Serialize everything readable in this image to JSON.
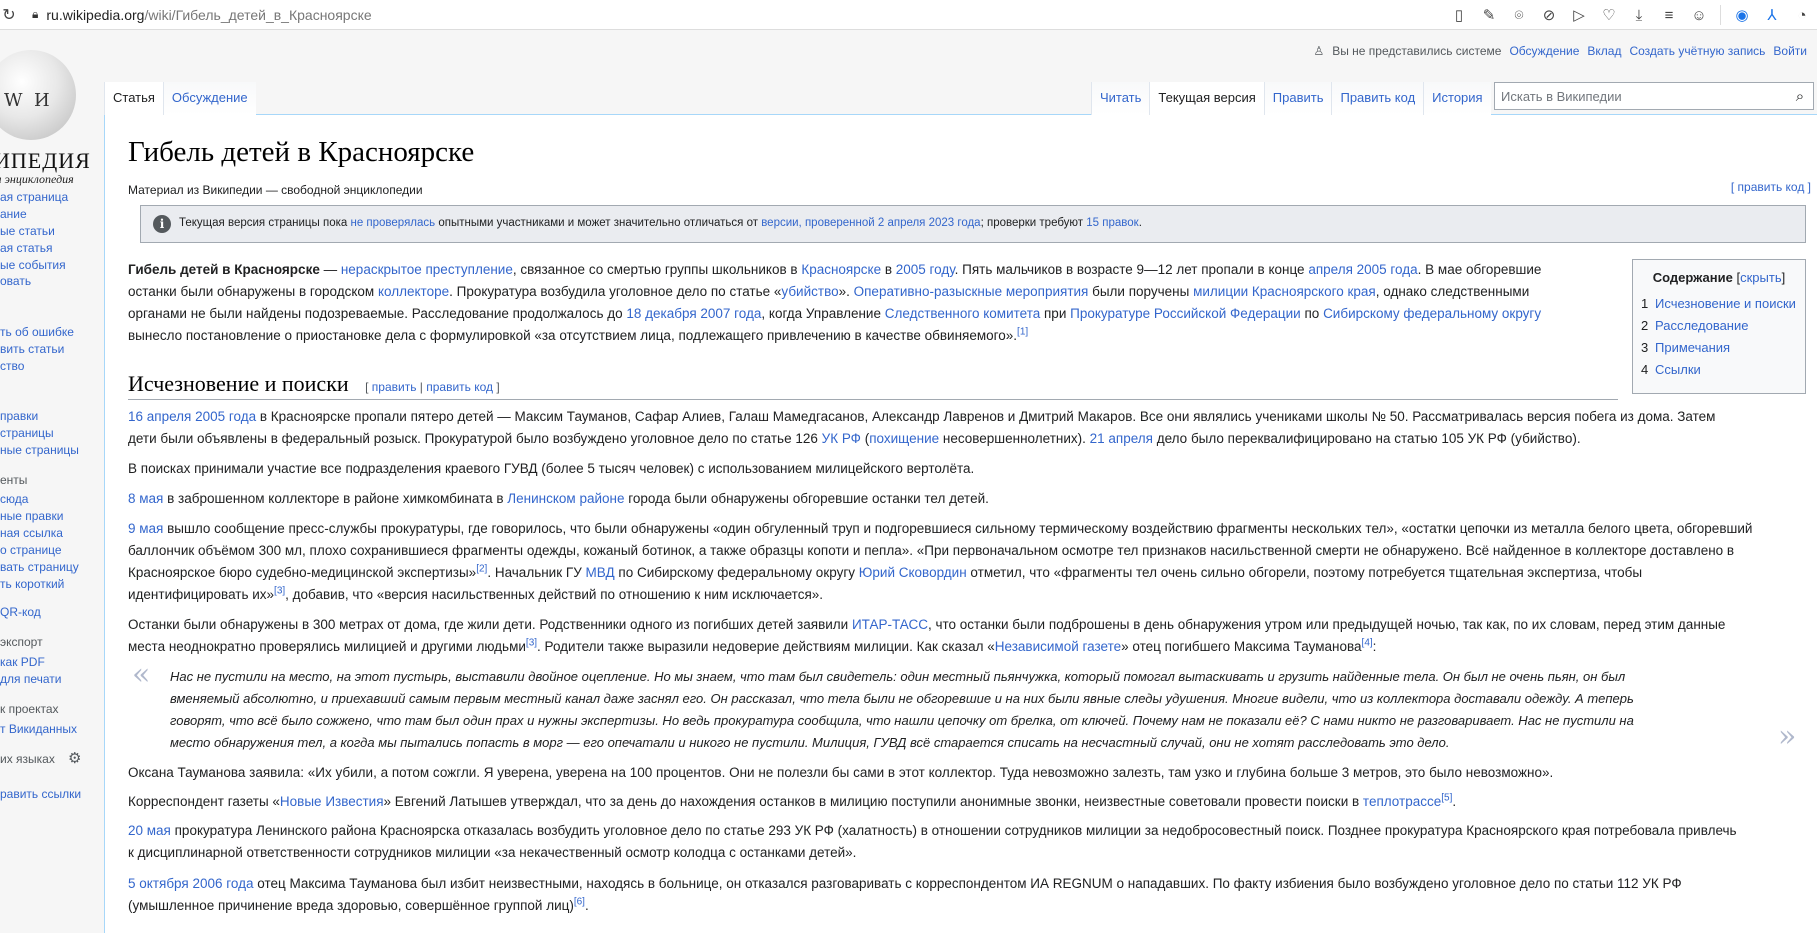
{
  "browser": {
    "url_host": "ru.wikipedia.org",
    "url_path": "/wiki/Гибель_детей_в_Красноярске"
  },
  "sidebar": {
    "logo_title": "ИПЕДИЯ",
    "logo_sub": "я энциклопедия",
    "nav": [
      "ая страница",
      "ание",
      "ые статьи",
      "ая статья",
      "ые события",
      "овать"
    ],
    "participate": [
      "ть об ошибке",
      "вить статьи",
      "ство",
      "",
      "правки",
      "страницы",
      "ные страницы"
    ],
    "tools_head": "енты",
    "tools": [
      "сюда",
      "ные правки",
      "ная ссылка",
      "о странице",
      "вать страницу",
      "ть короткий",
      "QR-код"
    ],
    "export_head": "экспорт",
    "export": [
      "как PDF",
      "для печати"
    ],
    "projects_head": "к проектах",
    "projects": [
      "т Викиданных"
    ],
    "langs_head": "их языках",
    "langs": [
      "",
      "равить ссылки"
    ]
  },
  "personal": {
    "anon": "Вы не представились системе",
    "links": [
      "Обсуждение",
      "Вклад",
      "Создать учётную запись",
      "Войти"
    ]
  },
  "tabs_left": [
    "Статья",
    "Обсуждение"
  ],
  "tabs_right": [
    "Читать",
    "Текущая версия",
    "Править",
    "Править код",
    "История"
  ],
  "search": {
    "placeholder": "Искать в Википедии"
  },
  "article": {
    "title": "Гибель детей в Красноярске",
    "site_sub": "Материал из Википедии — свободной энциклопедии",
    "edit_code": "[ править код ]",
    "notice": {
      "t1": "Текущая версия страницы пока ",
      "l1": "не проверялась",
      "t2": " опытными участниками и может значительно отличаться от ",
      "l2": "версии, проверенной 2 апреля 2023 года",
      "t3": "; проверки требуют ",
      "l3": "15 правок",
      "t4": "."
    },
    "toc": {
      "title": "Содержание",
      "hide": "скрыть",
      "items": [
        {
          "n": "1",
          "label": "Исчезновение и поиски"
        },
        {
          "n": "2",
          "label": "Расследование"
        },
        {
          "n": "3",
          "label": "Примечания"
        },
        {
          "n": "4",
          "label": "Ссылки"
        }
      ]
    },
    "intro": {
      "bold": "Гибель детей в Красноярске",
      "s1": " — ",
      "l1": "нераскрытое преступление",
      "s2": ", связанное со смертью группы школьников в ",
      "l2": "Красноярске",
      "s3": " в ",
      "l3": "2005 году",
      "s4": ". Пять мальчиков в возрасте 9—12 лет пропали в конце ",
      "l4": "апреля 2005 года",
      "s5": ". В мае обгоревшие",
      "s6": "останки были обнаружены в городском ",
      "l5": "коллекторе",
      "s7": ". Прокуратура возбудила уголовное дело по статье «",
      "l6": "убийство",
      "s8": "». ",
      "l7": "Оперативно-разыскные мероприятия",
      "s9": " были поручены ",
      "l8": "милиции Красноярского края",
      "s10": ", однако следственными",
      "s11": "органами не были найдены подозреваемые. Расследование продолжалось до ",
      "l9": "18 декабря 2007 года",
      "s12": ", когда Управление ",
      "l10": "Следственного комитета",
      "s13": " при ",
      "l11": "Прокуратуре Российской Федерации",
      "s14": " по ",
      "l12": "Сибирскому федеральному округу",
      "s15": "вынесло постановление о приостановке дела с формулировкой «за отсутствием лица, подлежащего привлечению в качестве обвиняемого».",
      "ref": "[1]"
    },
    "section1": {
      "title": "Исчезновение и поиски",
      "edit": "править",
      "edit_code": "править код"
    },
    "p1": {
      "l1": "16 апреля 2005 года",
      "s1": " в Красноярске пропали пятеро детей — Максим Тауманов, Сафар Алиев, Галаш Мамедгасанов, Александр Лавренов и Дмитрий Макаров. Все они являлись учениками школы № 50. Рассматривалась версия побега из дома. Затем",
      "s2": "дети были объявлены в федеральный розыск. Прокуратурой было возбуждено уголовное дело по статье 126 ",
      "l2": "УК РФ",
      "s3": " (",
      "l3": "похищение",
      "s4": " несовершеннолетних). ",
      "l4": "21 апреля",
      "s5": " дело было переквалифицировано на статью 105 УК РФ (убийство)."
    },
    "p2": "В поисках принимали участие все подразделения краевого ГУВД (более 5 тысяч человек) с использованием милицейского вертолёта.",
    "p3": {
      "l1": "8 мая",
      "s1": " в заброшенном коллекторе в районе химкомбината в ",
      "l2": "Ленинском районе",
      "s2": " города были обнаружены обгоревшие останки тел детей."
    },
    "p4": {
      "l1": "9 мая",
      "s1": " вышло сообщение пресс-службы прокуратуры, где говорилось, что были обнаружены «один обгуленный труп и подгоревшиеся сильному термическому воздействию фрагменты нескольких тел», «остатки цепочки из металла белого цвета, обгоревший",
      "s2": "баллончик объёмом 300 мл, плохо сохранившиеся фрагменты одежды, кожаный ботинок, а также образцы копоти и пепла». «При первоначальном осмотре тел признаков насильственной смерти не обнаружено. Всё найденное в коллекторе доставлено в",
      "s3": "Красноярское бюро судебно-медицинской экспертизы»",
      "ref1": "[2]",
      "s4": ". Начальник ГУ ",
      "l2": "МВД",
      "s5": " по Сибирскому федеральному округу ",
      "l3": "Юрий Сковордин",
      "s6": " отметил, что «фрагменты тел очень сильно обгорели, поэтому потребуется тщательная экспертиза, чтобы",
      "s7": "идентифицировать их»",
      "ref2": "[3]",
      "s8": ", добавив, что «версия насильственных действий по отношению к ним исключается»."
    },
    "p5": {
      "s1": "Останки были обнаружены в 300 метрах от дома, где жили дети. Родственники одного из погибших детей заявили ",
      "l1": "ИТАР-ТАСС",
      "s2": ", что останки были подброшены в день обнаружения утром или предыдущей ночью, так как, по их словам, перед этим данные",
      "s3": "места неоднократно проверялись милицией и другими людьми",
      "ref1": "[3]",
      "s4": ". Родители также выразили недоверие действиям милиции. Как сказал «",
      "l2": "Независимой газете",
      "s5": "» отец погибшего Максима Тауманова",
      "ref2": "[4]",
      "s6": ":"
    },
    "quote": {
      "open": "«",
      "close": "»",
      "lines": [
        "Нас не пустили на место, на этот пустырь, выставили двойное оцепление. Но мы знаем, что там был свидетель: один местный пьянчужка, который помогал вытаскивать и грузить найденные тела. Он был не очень пьян, он был",
        "вменяемый абсолютно, и приехавший самым первым местный канал даже заснял его. Он рассказал, что тела были не обгоревшие и на них были явные следы удушения. Многие видели, что из коллектора доставали одежду. А теперь",
        "говорят, что всё было сожжено, что там был один прах и нужны экспертизы. Но ведь прокуратура сообщила, что нашли цепочку от брелка, от ключей. Почему нам не показали её? С нами никто не разговаривает. Нас не пустили на",
        "место обнаружения тел, а когда мы пытались попасть в морг — его опечатали и никого не пустили. Милиция, ГУВД всё старается списать на несчастный случай, они не хотят расследовать это дело."
      ]
    },
    "p6": "Оксана Тауманова заявила: «Их убили, а потом сожгли. Я уверена, уверена на 100 процентов. Они не полезли бы сами в этот коллектор. Туда невозможно залезть, там узко и глубина больше 3 метров, это было невозможно».",
    "p7": {
      "s1": "Корреспондент газеты «",
      "l1": "Новые Известия",
      "s2": "» Евгений Латышев утверждал, что за день до нахождения останков в милицию поступили анонимные звонки, неизвестные советовали провести поиски в ",
      "l2": "теплотрассе",
      "ref": "[5]",
      "s3": "."
    },
    "p8": {
      "l1": "20 мая",
      "s1": " прокуратура Ленинского района Красноярска отказалась возбудить уголовное дело по статье 293 УК РФ (халатность) в отношении сотрудников милиции за недобросовестный поиск. Позднее прокуратура Красноярского края потребовала привлечь",
      "s2": "к дисциплинарной ответственности сотрудников милиции «за некачественный осмотр колодца с останками детей»."
    },
    "p9": {
      "l1": "5 октября 2006 года",
      "s1": " отец Максима Тауманова был избит неизвестными, находясь в больнице, он отказался разговаривать с корреспондентом ИА REGNUM о нападавших. По факту избиения было возбуждено уголовное дело по статьи 112 УК РФ",
      "s2": "(умышленное причинение вреда здоровью, совершённое группой лиц)",
      "ref": "[6]",
      "s3": "."
    }
  }
}
